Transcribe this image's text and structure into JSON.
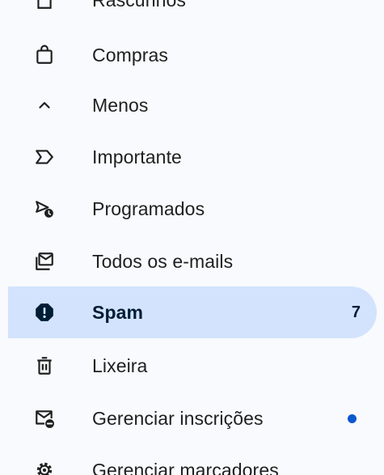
{
  "nav": {
    "items": [
      {
        "label": "Rascunhos",
        "icon": "draft-icon"
      },
      {
        "label": "Compras",
        "icon": "shopping-bag-icon"
      },
      {
        "label": "Menos",
        "icon": "chevron-up-icon"
      },
      {
        "label": "Importante",
        "icon": "label-important-icon"
      },
      {
        "label": "Programados",
        "icon": "scheduled-send-icon"
      },
      {
        "label": "Todos os e-mails",
        "icon": "all-mail-icon"
      },
      {
        "label": "Spam",
        "icon": "report-spam-icon",
        "count": "7",
        "active": true
      },
      {
        "label": "Lixeira",
        "icon": "trash-icon"
      },
      {
        "label": "Gerenciar inscrições",
        "icon": "manage-subscriptions-icon",
        "has_dot": true
      },
      {
        "label": "Gerenciar marcadores",
        "icon": "gear-icon"
      }
    ]
  },
  "colors": {
    "background": "#f8fafd",
    "active_background": "#d3e3fd",
    "dot": "#0b57d0",
    "text": "#1f1f1f"
  }
}
